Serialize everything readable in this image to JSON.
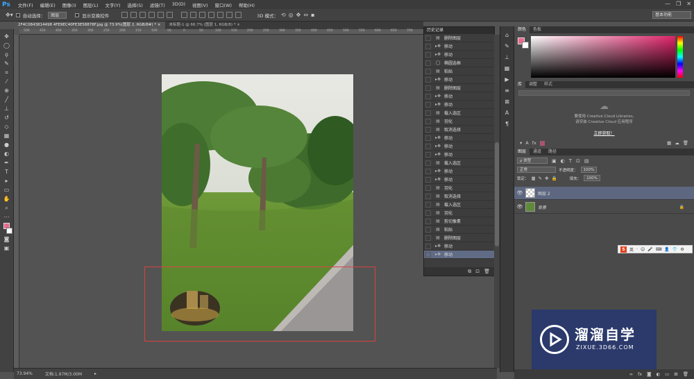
{
  "app": {
    "logo": "Ps",
    "menus": [
      "文件(F)",
      "编辑(E)",
      "图像(I)",
      "图层(L)",
      "文字(Y)",
      "选择(S)",
      "滤镜(T)",
      "3D(D)",
      "视图(V)",
      "窗口(W)",
      "帮助(H)"
    ],
    "window_controls": [
      "—",
      "❐",
      "✕"
    ],
    "workspace": "基本功能"
  },
  "options_bar": {
    "auto_select_label": "自动选择：",
    "auto_select_value": "图层",
    "show_transform_label": "显示变换控件",
    "mode_3d_label": "3D 模式："
  },
  "tabs": [
    {
      "label": "2F4C0843814498 4FE9EC40FE3E58878F.jpg @ 73.9%(图层 2, RGB/8#) *",
      "close": "×"
    },
    {
      "label": "未标题-1 @ 66.7% (图层 1, RGB/8) *",
      "close": "×"
    }
  ],
  "ruler_ticks": [
    "500",
    "450",
    "400",
    "350",
    "300",
    "250",
    "200",
    "150",
    "100",
    "50",
    "0",
    "50",
    "100",
    "150",
    "200",
    "250",
    "300",
    "350",
    "400",
    "450",
    "500",
    "550",
    "600",
    "650",
    "700"
  ],
  "status": {
    "zoom": "73.94%",
    "doc": "文档:1.97M/3.00M"
  },
  "history": {
    "title": "历史记录",
    "items": [
      {
        "icon": "doc",
        "label": "删除图层"
      },
      {
        "icon": "move",
        "label": "移动"
      },
      {
        "icon": "move",
        "label": "移动"
      },
      {
        "icon": "ellipse",
        "label": "椭圆选框"
      },
      {
        "icon": "doc",
        "label": "粘贴"
      },
      {
        "icon": "move",
        "label": "移动"
      },
      {
        "icon": "doc",
        "label": "删除图层"
      },
      {
        "icon": "move",
        "label": "移动"
      },
      {
        "icon": "move",
        "label": "移动"
      },
      {
        "icon": "doc",
        "label": "载入选区"
      },
      {
        "icon": "doc",
        "label": "羽化"
      },
      {
        "icon": "doc",
        "label": "取消选择"
      },
      {
        "icon": "move",
        "label": "移动"
      },
      {
        "icon": "move",
        "label": "移动"
      },
      {
        "icon": "move",
        "label": "移动"
      },
      {
        "icon": "doc",
        "label": "载入选区"
      },
      {
        "icon": "move",
        "label": "移动"
      },
      {
        "icon": "move",
        "label": "移动"
      },
      {
        "icon": "doc",
        "label": "羽化"
      },
      {
        "icon": "doc",
        "label": "取消选择"
      },
      {
        "icon": "doc",
        "label": "载入选区"
      },
      {
        "icon": "doc",
        "label": "羽化"
      },
      {
        "icon": "doc",
        "label": "剪切像素"
      },
      {
        "icon": "doc",
        "label": "粘贴"
      },
      {
        "icon": "doc",
        "label": "删除图层"
      },
      {
        "icon": "move",
        "label": "移动"
      },
      {
        "icon": "move",
        "label": "移动"
      }
    ],
    "active_index": 26
  },
  "color_panel": {
    "tabs": [
      "颜色",
      "色板"
    ],
    "fg": "#e86a8d",
    "bg": "#ffffff"
  },
  "libraries": {
    "tabs": [
      "库",
      "调整",
      "样式"
    ],
    "msg1": "要使用 Creative Cloud Libraries,",
    "msg2": "请安装 Creative Cloud 应用程序",
    "link": "立即获取！"
  },
  "layers": {
    "tabs": [
      "图层",
      "通道",
      "路径"
    ],
    "filter_label": "ρ 类型",
    "blend": "正常",
    "opacity_label": "不透明度：",
    "opacity": "100%",
    "lock_label": "锁定：",
    "fill_label": "填充：",
    "fill": "100%",
    "rows": [
      {
        "name": "图层 2"
      },
      {
        "name": "背景"
      }
    ]
  },
  "ime": {
    "logo": "S",
    "lang": "英"
  },
  "watermark": {
    "title": "溜溜自学",
    "url": "ZIXUE.3D66.COM"
  },
  "colors": {
    "selection": "#d94242",
    "accent": "#606b86"
  }
}
